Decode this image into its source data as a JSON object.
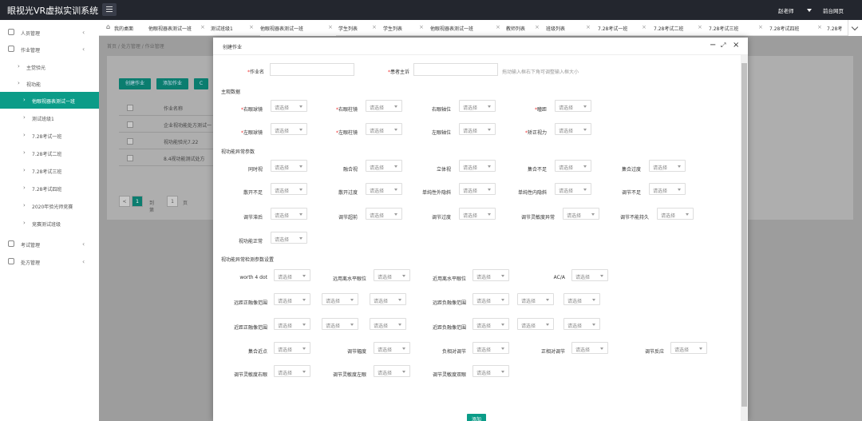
{
  "app": {
    "title": "眼视光VR虚拟实训系统",
    "user": "赵老师",
    "home_link": "前台网页"
  },
  "sidebar": {
    "items": [
      {
        "label": "人员管理",
        "level": 0
      },
      {
        "label": "作业管理",
        "level": 0
      },
      {
        "label": "主觉验光",
        "level": 1
      },
      {
        "label": "视功能",
        "level": 1
      },
      {
        "label": "他眼视器表测试一班",
        "level": 2,
        "active": true
      },
      {
        "label": "测试班级1",
        "level": 2
      },
      {
        "label": "7.28考试一班",
        "level": 2
      },
      {
        "label": "7.28考试二班",
        "level": 2
      },
      {
        "label": "7.28考试三班",
        "level": 2
      },
      {
        "label": "7.28考试四班",
        "level": 2
      },
      {
        "label": "2020年验光师竞赛",
        "level": 2
      },
      {
        "label": "竞赛测试班级",
        "level": 2
      },
      {
        "label": "考试管理",
        "level": 0
      },
      {
        "label": "处方管理",
        "level": 0
      }
    ]
  },
  "tabs": [
    {
      "label": "我的桌面",
      "home": true
    },
    {
      "label": "他眼视器表测试一班"
    },
    {
      "label": "测试班级1"
    },
    {
      "label": "他眼视器表测试一班",
      "active": true
    },
    {
      "label": "学生列表"
    },
    {
      "label": "学生列表"
    },
    {
      "label": "他眼视器表测试一班"
    },
    {
      "label": "教师列表"
    },
    {
      "label": "班级列表"
    },
    {
      "label": "7.28考试一班"
    },
    {
      "label": "7.28考试二班"
    },
    {
      "label": "7.28考试三班"
    },
    {
      "label": "7.28考试四班"
    },
    {
      "label": "7.28考"
    }
  ],
  "background": {
    "breadcrumb": "首页 / 处方管理 / 作业管理",
    "buttons": [
      "创建作业",
      "添加作业",
      "C"
    ],
    "table_header": "作业名称",
    "rows": [
      "企业视功能处方测试一",
      "视功能验光7.22",
      "8.4视功能测试处方"
    ],
    "pager": {
      "prev": "<",
      "current": "1",
      "goto": "到第",
      "page": "1",
      "unit": "页"
    }
  },
  "modal": {
    "title": "创建作业",
    "name_label": "作业名",
    "complaint_label": "患者主诉",
    "complaint_hint": "拖动输入框右下角可调整输入框大小",
    "placeholder": "请选择",
    "sections": {
      "subjective": "主观数据",
      "abnormal": "视功能异常参数",
      "detection": "视功能异常检测参数设置"
    },
    "subjective_row1": [
      "右眼球镜",
      "右眼柱镜",
      "右眼轴位",
      "瞳距"
    ],
    "subjective_row2": [
      "左眼球镜",
      "左眼柱镜",
      "左眼轴位",
      "矫正视力"
    ],
    "abnormal_row1": [
      "同时视",
      "融合视",
      "立体视",
      "集合不足",
      "集合过度"
    ],
    "abnormal_row2": [
      "散开不足",
      "散开过度",
      "单纯性外隐斜",
      "单纯性内隐斜",
      "调节不足"
    ],
    "abnormal_row3": [
      "调节滞后",
      "调节超前",
      "调节过度",
      "调节灵敏度异常",
      "调节不能持久"
    ],
    "abnormal_row4": [
      "视功能正常"
    ],
    "detect_row1": [
      "worth 4 dot",
      "远用离水平眼位",
      "近用离水平眼位",
      "AC/A"
    ],
    "detect_row2": [
      "远距正融像范围",
      "远距负融像范围"
    ],
    "detect_row3": [
      "近距正融像范围",
      "近距负融像范围"
    ],
    "detect_row4": [
      "集合近点",
      "调节幅度",
      "负相对调节",
      "正相对调节",
      "调节反应"
    ],
    "detect_row5": [
      "调节灵敏度右眼",
      "调节灵敏度左眼",
      "调节灵敏度双眼"
    ],
    "submit": "添加"
  }
}
